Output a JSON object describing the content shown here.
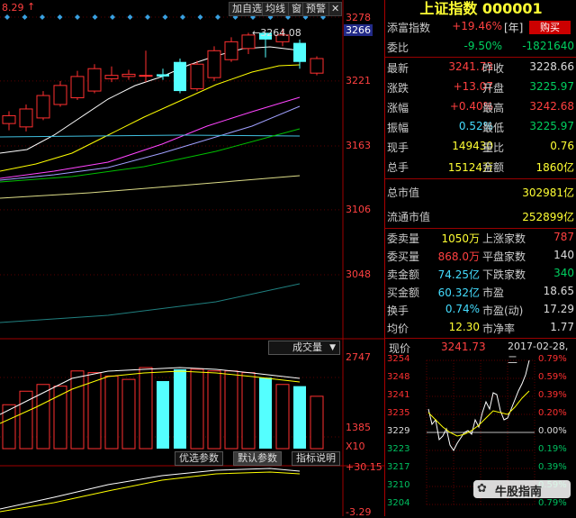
{
  "chart": {
    "top_left_price": "8.29",
    "toolbar": {
      "add_watchlist": "加自选",
      "ma": "均线",
      "window": "窗",
      "warn": "预警"
    },
    "price_axis": [
      "3278",
      "3266",
      "3221",
      "3163",
      "3106",
      "3048"
    ],
    "high_marker": "3264.08",
    "volume_label": "成交量",
    "volume_axis": [
      "2747",
      "1385",
      "X10"
    ],
    "tabs": {
      "preset": "优选参数",
      "default": "默认参数",
      "help": "指标说明"
    },
    "indicator_axis": [
      "+30.15",
      "-3.29"
    ],
    "candles": [
      {
        "o": 3183,
        "c": 3190,
        "h": 3194,
        "l": 3177
      },
      {
        "o": 3180,
        "c": 3196,
        "h": 3200,
        "l": 3176
      },
      {
        "o": 3188,
        "c": 3208,
        "h": 3212,
        "l": 3186
      },
      {
        "o": 3200,
        "c": 3217,
        "h": 3221,
        "l": 3198
      },
      {
        "o": 3206,
        "c": 3225,
        "h": 3230,
        "l": 3204
      },
      {
        "o": 3212,
        "c": 3232,
        "h": 3236,
        "l": 3210
      },
      {
        "o": 3223,
        "c": 3226,
        "h": 3234,
        "l": 3220
      },
      {
        "o": 3225,
        "c": 3227,
        "h": 3231,
        "l": 3222
      },
      {
        "o": 3226,
        "c": 3226,
        "h": 3248,
        "l": 3220
      },
      {
        "o": 3227,
        "c": 3225,
        "h": 3232,
        "l": 3222
      },
      {
        "o": 3238,
        "c": 3212,
        "h": 3241,
        "l": 3210
      },
      {
        "o": 3214,
        "c": 3236,
        "h": 3239,
        "l": 3212
      },
      {
        "o": 3224,
        "c": 3248,
        "h": 3252,
        "l": 3221
      },
      {
        "o": 3240,
        "c": 3256,
        "h": 3260,
        "l": 3238
      },
      {
        "o": 3250,
        "c": 3262,
        "h": 3264,
        "l": 3245
      },
      {
        "o": 3264,
        "c": 3258,
        "h": 3264.08,
        "l": 3242
      },
      {
        "o": 3256,
        "c": 3262,
        "h": 3268,
        "l": 3252
      },
      {
        "o": 3255,
        "c": 3238,
        "h": 3258,
        "l": 3232
      },
      {
        "o": 3228,
        "c": 3241,
        "h": 3243,
        "l": 3226
      }
    ],
    "volumes": [
      1300,
      1700,
      1900,
      1850,
      2300,
      2250,
      2150,
      2050,
      2400,
      2000,
      2350,
      2350,
      2300,
      2300,
      2250,
      2100,
      1900,
      1850,
      1550
    ]
  },
  "quote": {
    "title": "上证指数 000001",
    "rows": [
      {
        "l1": "添富指数",
        "v1": "+19.46%",
        "extra": "[年]",
        "btn": "购买"
      },
      {
        "l1": "委比",
        "v1": "-9.50%",
        "v2": "-1821640"
      },
      {
        "l1": "最新",
        "v1": "3241.73",
        "l2": "昨收",
        "v2": "3228.66"
      },
      {
        "l1": "涨跌",
        "v1": "+13.07",
        "l2": "开盘",
        "v2": "3225.97"
      },
      {
        "l1": "涨幅",
        "v1": "+0.40%",
        "l2": "最高",
        "v2": "3242.68"
      },
      {
        "l1": "振幅",
        "v1": "0.52%",
        "l2": "最低",
        "v2": "3225.97"
      },
      {
        "l1": "现手",
        "v1": "149430",
        "l2": "量比",
        "v2": "0.76"
      },
      {
        "l1": "总手",
        "v1": "15124万",
        "l2": "金额",
        "v2": "1860亿"
      }
    ],
    "total_cap": {
      "label": "总市值",
      "value": "302981亿"
    },
    "float_cap": {
      "label": "流通市值",
      "value": "252899亿"
    },
    "book": [
      {
        "l1": "委卖量",
        "v1": "1050万",
        "l2": "上涨家数",
        "v2": "787"
      },
      {
        "l1": "委买量",
        "v1": "868.0万",
        "l2": "平盘家数",
        "v2": "140"
      },
      {
        "l1": "卖金额",
        "v1": "74.25亿",
        "l2": "下跌家数",
        "v2": "340"
      },
      {
        "l1": "买金额",
        "v1": "60.32亿",
        "l2": "市盈",
        "v2": "18.65"
      },
      {
        "l1": "换手",
        "v1": "0.74%",
        "l2": "市盈(动)",
        "v2": "17.29"
      },
      {
        "l1": "均价",
        "v1": "12.30",
        "l2": "市净率",
        "v2": "1.77"
      }
    ],
    "mini": {
      "label": "现价",
      "price": "3241.73",
      "date": "2017-02-28,二",
      "left_axis": [
        "3254",
        "3248",
        "3241",
        "3235",
        "3229",
        "3223",
        "3217",
        "3210",
        "3204"
      ],
      "right_axis": [
        "0.79%",
        "0.59%",
        "0.39%",
        "0.20%",
        "0.00%",
        "0.19%",
        "0.39%",
        "0.59%",
        "0.79%"
      ]
    },
    "watermark": "牛股指南"
  }
}
